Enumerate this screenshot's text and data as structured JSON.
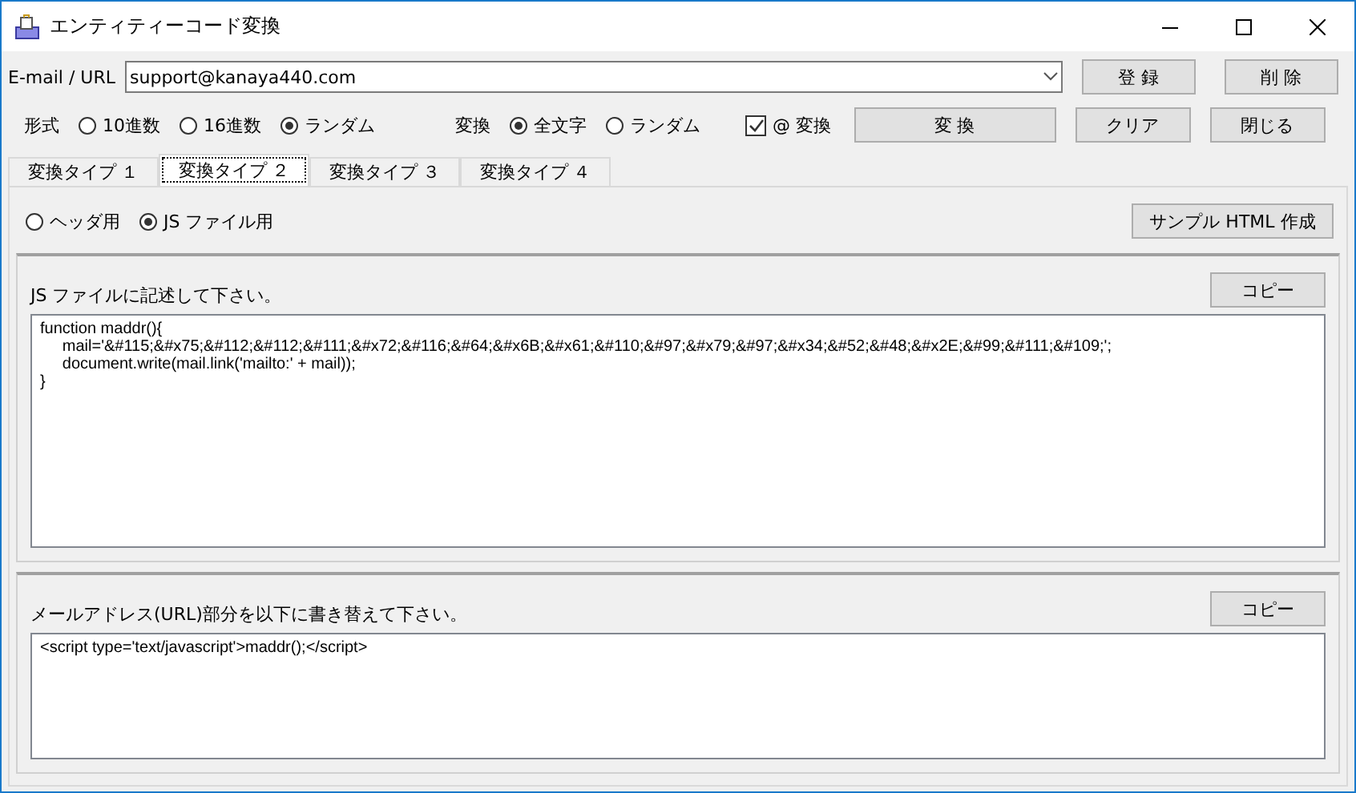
{
  "window": {
    "title": "エンティティーコード変換"
  },
  "email": {
    "label": "E-mail / URL",
    "value": "support@kanaya440.com"
  },
  "top_buttons": [
    "登 録",
    "削 除"
  ],
  "format": {
    "label": "形式",
    "options": [
      {
        "label": "10進数",
        "selected": false
      },
      {
        "label": "16進数",
        "selected": false
      },
      {
        "label": "ランダム",
        "selected": true
      }
    ]
  },
  "convert": {
    "label": "変換",
    "options": [
      {
        "label": "全文字",
        "selected": true
      },
      {
        "label": "ランダム",
        "selected": false
      }
    ]
  },
  "at_convert": {
    "label": "@ 変換",
    "checked": true
  },
  "action_buttons": [
    "変 換",
    "クリア",
    "閉じる"
  ],
  "tabs": [
    {
      "label": "変換タイプ １",
      "selected": false
    },
    {
      "label": "変換タイプ ２",
      "selected": true
    },
    {
      "label": "変換タイプ ３",
      "selected": false
    },
    {
      "label": "変換タイプ ４",
      "selected": false
    }
  ],
  "mode": [
    {
      "label": "ヘッダ用",
      "selected": false
    },
    {
      "label": "JS ファイル用",
      "selected": true
    }
  ],
  "sample_button": "サンプル HTML 作成",
  "sections": [
    {
      "label": "JS ファイルに記述して下さい。",
      "copy_button": "コピー",
      "code_lines": [
        "function maddr(){",
        "     mail='&#115;&#x75;&#112;&#112;&#111;&#x72;&#116;&#64;&#x6B;&#x61;&#110;&#97;&#x79;&#97;&#x34;&#52;&#48;&#x2E;&#99;&#111;&#109;';",
        "     document.write(mail.link('mailto:' + mail));",
        "}"
      ]
    },
    {
      "label": "メールアドレス(URL)部分を以下に書き替えて下さい。",
      "copy_button": "コピー",
      "code_lines": [
        "<script type='text/javascript'>maddr();</script>"
      ]
    }
  ]
}
